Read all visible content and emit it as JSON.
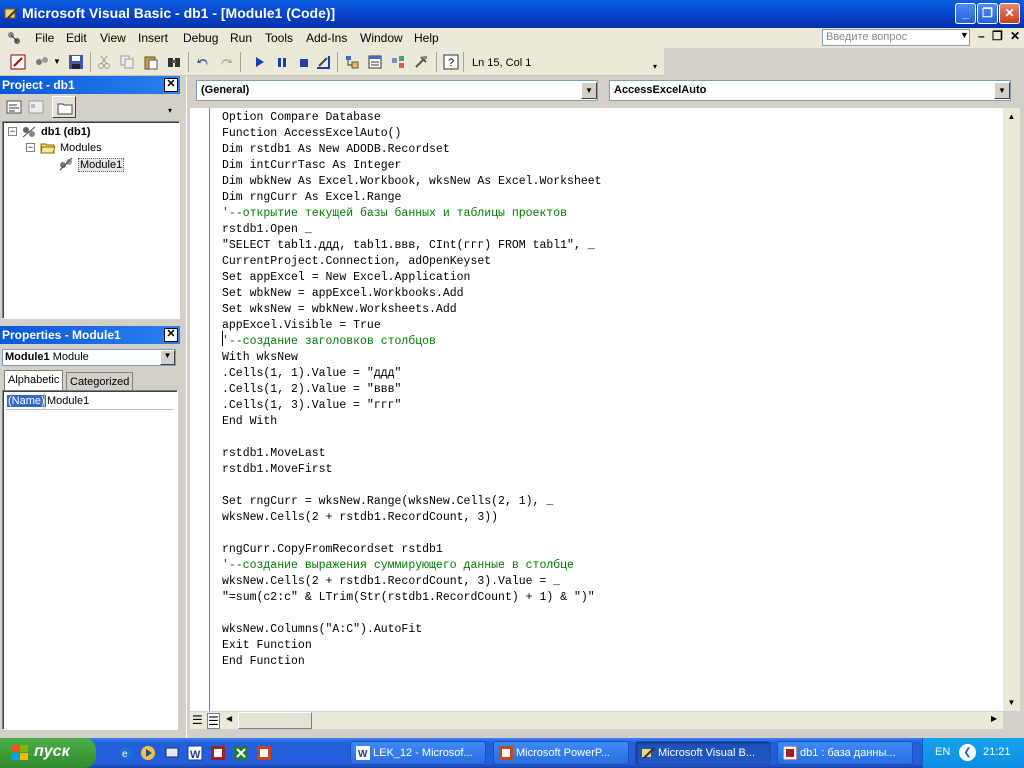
{
  "window": {
    "title": "Microsoft Visual Basic - db1 - [Module1 (Code)]"
  },
  "menu": {
    "items": [
      "File",
      "Edit",
      "View",
      "Insert",
      "Debug",
      "Run",
      "Tools",
      "Add-Ins",
      "Window",
      "Help"
    ],
    "ask_placeholder": "Введите вопрос"
  },
  "toolbar": {
    "position": "Ln 15, Col 1"
  },
  "project": {
    "title": "Project - db1",
    "root": "db1 (db1)",
    "folder": "Modules",
    "module": "Module1"
  },
  "properties": {
    "title": "Properties - Module1",
    "object_name": "Module1",
    "object_type": "Module",
    "tab_alphabetic": "Alphabetic",
    "tab_categorized": "Categorized",
    "prop_name": "(Name)",
    "prop_value": "Module1"
  },
  "code_window": {
    "object_combo": "(General)",
    "proc_combo": "AccessExcelAuto",
    "lines": [
      "Option Compare Database",
      "Function AccessExcelAuto()",
      "Dim rstdb1 As New ADODB.Recordset",
      "Dim intCurrTasc As Integer",
      "Dim wbkNew As Excel.Workbook, wksNew As Excel.Worksheet",
      "Dim rngCurr As Excel.Range",
      "'--открытие текущей базы банных и таблицы проектов",
      "rstdb1.Open _",
      "\"SELECT tabl1.ддд, tabl1.ввв, CInt(ггг) FROM tabl1\", _",
      "CurrentProject.Connection, adOpenKeyset",
      "Set appExcel = New Excel.Application",
      "Set wbkNew = appExcel.Workbooks.Add",
      "Set wksNew = wbkNew.Worksheets.Add",
      "appExcel.Visible = True",
      "'--создание заголовков столбцов",
      "With wksNew",
      ".Cells(1, 1).Value = \"ддд\"",
      ".Cells(1, 2).Value = \"ввв\"",
      ".Cells(1, 3).Value = \"ггг\"",
      "End With",
      "",
      "rstdb1.MoveLast",
      "rstdb1.MoveFirst",
      "",
      "Set rngCurr = wksNew.Range(wksNew.Cells(2, 1), _",
      "wksNew.Cells(2 + rstdb1.RecordCount, 3))",
      "",
      "rngCurr.CopyFromRecordset rstdb1",
      "'--создание выражения суммирующего данные в столбце",
      "wksNew.Cells(2 + rstdb1.RecordCount, 3).Value = _",
      "\"=sum(c2:c\" & LTrim(Str(rstdb1.RecordCount) + 1) & \")\"",
      "",
      "wksNew.Columns(\"A:C\").AutoFit",
      "Exit Function",
      "End Function"
    ]
  },
  "taskbar": {
    "start": "пуск",
    "tasks": [
      "LEK_12 - Microsof...",
      "Microsoft PowerP...",
      "Microsoft Visual B...",
      "db1 : база данны..."
    ],
    "lang": "EN",
    "time": "21:21"
  }
}
